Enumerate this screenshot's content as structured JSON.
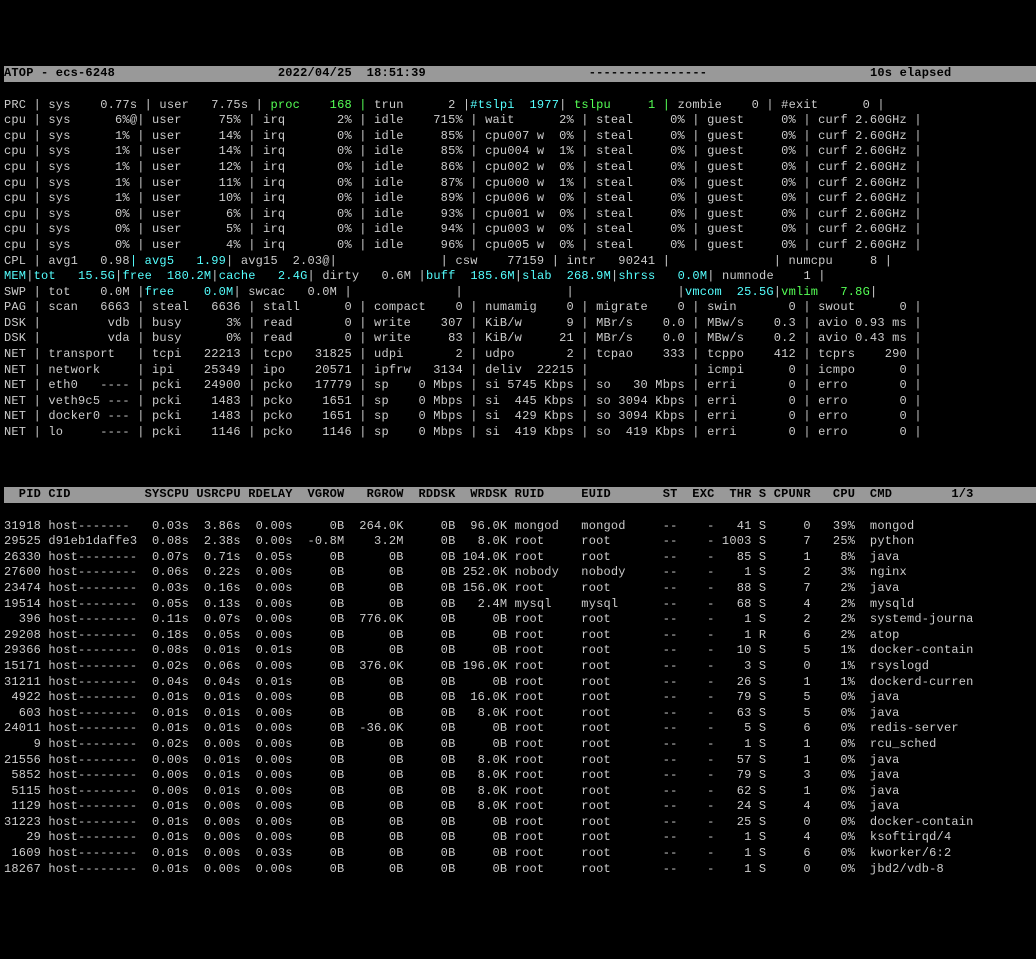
{
  "header": {
    "host": "ATOP - ecs-6248",
    "datetime": "2022/04/25  18:51:39",
    "dash": "----------------",
    "elapsed": "10s elapsed"
  },
  "sys": [
    "PRC | sys    0.77s | user   7.75s | #proc    168 | #trun      2 |@#tslpi  1977@| #tslpu     1 | #zombie    0 | #exit      0 |",
    "cpu | sys      6%@| user     75% | irq       2% | idle    715% | wait      2% | steal     0% | guest     0% | curf 2.60GHz |",
    "cpu | sys      1% | user     14% | irq       0% | idle     85% | cpu007 w  0% | steal     0% | guest     0% | curf 2.60GHz |",
    "cpu | sys      1% | user     14% | irq       0% | idle     85% | cpu004 w  1% | steal     0% | guest     0% | curf 2.60GHz |",
    "cpu | sys      1% | user     12% | irq       0% | idle     86% | cpu002 w  0% | steal     0% | guest     0% | curf 2.60GHz |",
    "cpu | sys      1% | user     11% | irq       0% | idle     87% | cpu000 w  1% | steal     0% | guest     0% | curf 2.60GHz |",
    "cpu | sys      1% | user     10% | irq       0% | idle     89% | cpu006 w  0% | steal     0% | guest     0% | curf 2.60GHz |",
    "cpu | sys      0% | user      6% | irq       0% | idle     93% | cpu001 w  0% | steal     0% | guest     0% | curf 2.60GHz |",
    "cpu | sys      0% | user      5% | irq       0% | idle     94% | cpu003 w  0% | steal     0% | guest     0% | curf 2.60GHz |",
    "cpu | sys      0% | user      4% | irq       0% | idle     96% | cpu005 w  0% | steal     0% | guest     0% | curf 2.60GHz |",
    "CPL | avg1   0.98@| avg5   1.99@| avg15  2.03@|              | csw    77159 | intr   90241 |              | numcpu     8 |",
    "~MEM~|~tot   15.5G~|~free  180.2M~|~cache   2.4G~| dirty   0.6M |~buff  185.6M~|~slab  268.9M~|~shrss   0.0M~| numnode    1 |",
    "SWP | tot    0.0M |@free    0.0M@| swcac   0.0M |              |              |              |~vmcom  25.5G~|#vmlim   7.8G#|",
    "PAG | scan   6663 | steal   6636 | stall      0 | compact    0 | numamig    0 | migrate    0 | swin       0 | swout      0 |",
    "DSK |         vdb | busy      3% | read       0 | write    307 | KiB/w      9 | MBr/s    0.0 | MBw/s    0.3 | avio 0.93 ms |",
    "DSK |         vda | busy      0% | read       0 | write     83 | KiB/w     21 | MBr/s    0.0 | MBw/s    0.2 | avio 0.43 ms |",
    "NET | transport   | tcpi   22213 | tcpo   31825 | udpi       2 | udpo       2 | tcpao    333 | tcppo    412 | tcprs    290 |",
    "NET | network     | ipi    25349 | ipo    20571 | ipfrw   3134 | deliv  22215 |              | icmpi      0 | icmpo      0 |",
    "NET | eth0   ---- | pcki   24900 | pcko   17779 | sp    0 Mbps | si 5745 Kbps | so   30 Mbps | erri       0 | erro       0 |",
    "NET | veth9c5 --- | pcki    1483 | pcko    1651 | sp    0 Mbps | si  445 Kbps | so 3094 Kbps | erri       0 | erro       0 |",
    "NET | docker0 --- | pcki    1483 | pcko    1651 | sp    0 Mbps | si  429 Kbps | so 3094 Kbps | erri       0 | erro       0 |",
    "NET | lo     ---- | pcki    1146 | pcko    1146 | sp    0 Mbps | si  419 Kbps | so  419 Kbps | erri       0 | erro       0 |"
  ],
  "procheader": "  PID CID          SYSCPU USRCPU RDELAY  VGROW   RGROW  RDDSK  WRDSK RUID     EUID       ST  EXC  THR S CPUNR   CPU  CMD        1/3",
  "procs": [
    "31918 host-------   0.03s  3.86s  0.00s     0B  264.0K     0B  96.0K mongod   mongod     --    -   41 S     0   39%  mongod",
    "29525 d91eb1daffe3  0.08s  2.38s  0.00s  -0.8M    3.2M     0B   8.0K root     root       --    - 1003 S     7   25%  python",
    "26330 host--------  0.07s  0.71s  0.05s     0B      0B     0B 104.0K root     root       --    -   85 S     1    8%  java",
    "27600 host--------  0.06s  0.22s  0.00s     0B      0B     0B 252.0K nobody   nobody     --    -    1 S     2    3%  nginx",
    "23474 host--------  0.03s  0.16s  0.00s     0B      0B     0B 156.0K root     root       --    -   88 S     7    2%  java",
    "19514 host--------  0.05s  0.13s  0.00s     0B      0B     0B   2.4M mysql    mysql      --    -   68 S     4    2%  mysqld",
    "  396 host--------  0.11s  0.07s  0.00s     0B  776.0K     0B     0B root     root       --    -    1 S     2    2%  systemd-journa",
    "29208 host--------  0.18s  0.05s  0.00s     0B      0B     0B     0B root     root       --    -    1 R     6    2%  atop",
    "29366 host--------  0.08s  0.01s  0.01s     0B      0B     0B     0B root     root       --    -   10 S     5    1%  docker-contain",
    "15171 host--------  0.02s  0.06s  0.00s     0B  376.0K     0B 196.0K root     root       --    -    3 S     0    1%  rsyslogd",
    "31211 host--------  0.04s  0.04s  0.01s     0B      0B     0B     0B root     root       --    -   26 S     1    1%  dockerd-curren",
    " 4922 host--------  0.01s  0.01s  0.00s     0B      0B     0B  16.0K root     root       --    -   79 S     5    0%  java",
    "  603 host--------  0.01s  0.01s  0.00s     0B      0B     0B   8.0K root     root       --    -   63 S     5    0%  java",
    "24011 host--------  0.01s  0.01s  0.00s     0B  -36.0K     0B     0B root     root       --    -    5 S     6    0%  redis-server",
    "    9 host--------  0.02s  0.00s  0.00s     0B      0B     0B     0B root     root       --    -    1 S     1    0%  rcu_sched",
    "21556 host--------  0.00s  0.01s  0.00s     0B      0B     0B   8.0K root     root       --    -   57 S     1    0%  java",
    " 5852 host--------  0.00s  0.01s  0.00s     0B      0B     0B   8.0K root     root       --    -   79 S     3    0%  java",
    " 5115 host--------  0.00s  0.01s  0.00s     0B      0B     0B   8.0K root     root       --    -   62 S     1    0%  java",
    " 1129 host--------  0.01s  0.00s  0.00s     0B      0B     0B   8.0K root     root       --    -   24 S     4    0%  java",
    "31223 host--------  0.01s  0.00s  0.00s     0B      0B     0B     0B root     root       --    -   25 S     0    0%  docker-contain",
    "   29 host--------  0.01s  0.00s  0.00s     0B      0B     0B     0B root     root       --    -    1 S     4    0%  ksoftirqd/4",
    " 1609 host--------  0.01s  0.00s  0.03s     0B      0B     0B     0B root     root       --    -    1 S     6    0%  kworker/6:2",
    "18267 host--------  0.01s  0.00s  0.00s     0B      0B     0B     0B root     root       --    -    1 S     0    0%  jbd2/vdb-8"
  ]
}
